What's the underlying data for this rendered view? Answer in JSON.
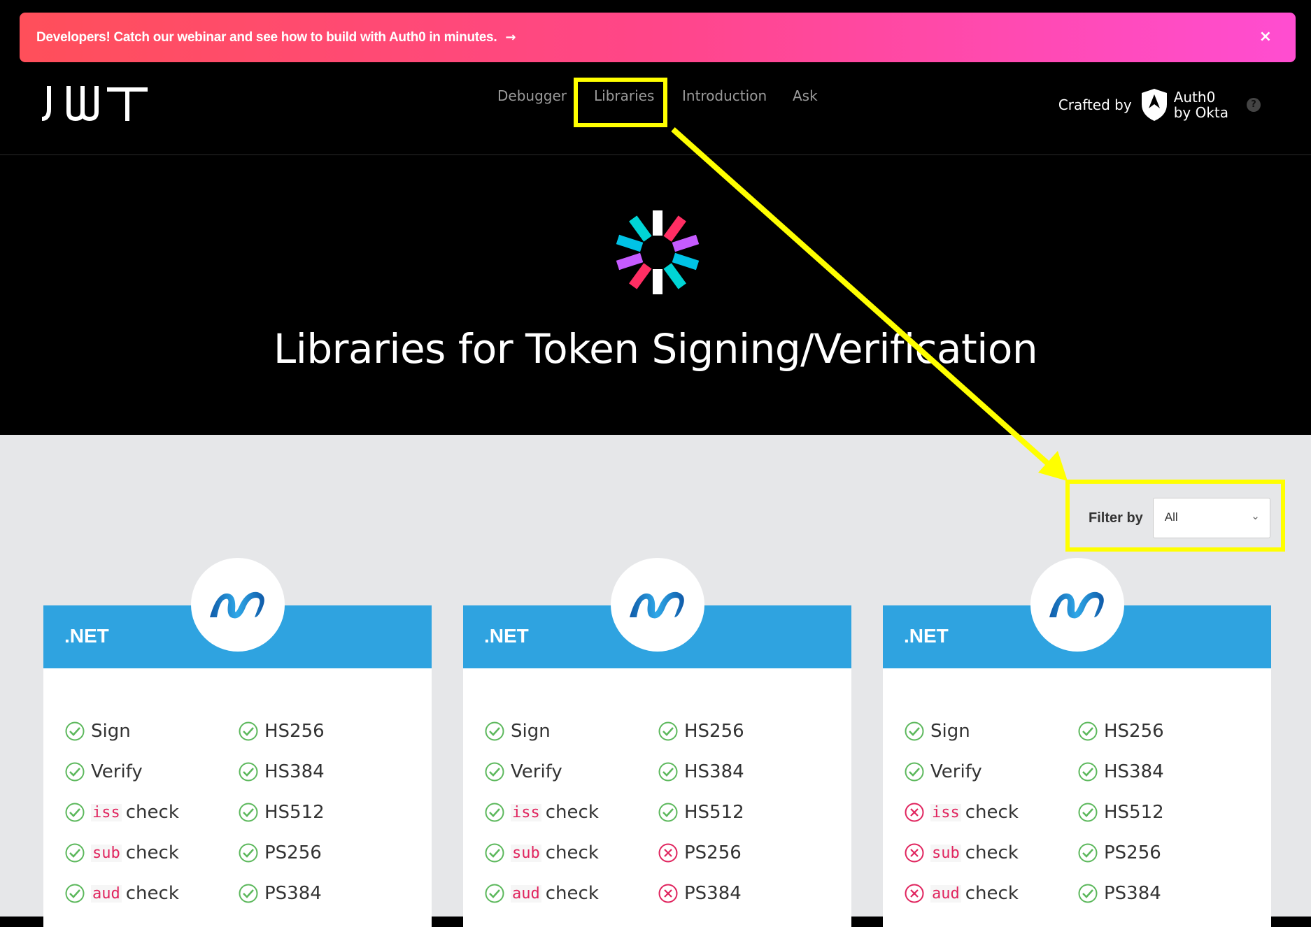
{
  "banner": {
    "text": "Developers! Catch our webinar and see how to build with Auth0 in minutes.",
    "arrow": "→",
    "close": "×"
  },
  "header": {
    "logo_text": "JWT",
    "nav": [
      "Debugger",
      "Libraries",
      "Introduction",
      "Ask"
    ],
    "crafted_by": "Crafted by",
    "brand_line1": "Auth0",
    "brand_line2": "by Okta",
    "help": "?"
  },
  "hero": {
    "title": "Libraries for Token Signing/Verification"
  },
  "filter": {
    "label": "Filter by",
    "value": "All"
  },
  "colors": {
    "accent_blue": "#2fa3e0",
    "check_green": "#5cb85c",
    "cross_red": "#e0245e",
    "highlight": "#ffff00"
  },
  "cards": [
    {
      "title": ".NET",
      "left": [
        {
          "pre": "",
          "code": "",
          "label": "Sign",
          "ok": true
        },
        {
          "pre": "",
          "code": "",
          "label": "Verify",
          "ok": true
        },
        {
          "pre": "",
          "code": "iss",
          "label": "check",
          "ok": true
        },
        {
          "pre": "",
          "code": "sub",
          "label": "check",
          "ok": true
        },
        {
          "pre": "",
          "code": "aud",
          "label": "check",
          "ok": true
        }
      ],
      "right": [
        {
          "label": "HS256",
          "ok": true
        },
        {
          "label": "HS384",
          "ok": true
        },
        {
          "label": "HS512",
          "ok": true
        },
        {
          "label": "PS256",
          "ok": true
        },
        {
          "label": "PS384",
          "ok": true
        }
      ]
    },
    {
      "title": ".NET",
      "left": [
        {
          "pre": "",
          "code": "",
          "label": "Sign",
          "ok": true
        },
        {
          "pre": "",
          "code": "",
          "label": "Verify",
          "ok": true
        },
        {
          "pre": "",
          "code": "iss",
          "label": "check",
          "ok": true
        },
        {
          "pre": "",
          "code": "sub",
          "label": "check",
          "ok": true
        },
        {
          "pre": "",
          "code": "aud",
          "label": "check",
          "ok": true
        }
      ],
      "right": [
        {
          "label": "HS256",
          "ok": true
        },
        {
          "label": "HS384",
          "ok": true
        },
        {
          "label": "HS512",
          "ok": true
        },
        {
          "label": "PS256",
          "ok": false
        },
        {
          "label": "PS384",
          "ok": false
        }
      ]
    },
    {
      "title": ".NET",
      "left": [
        {
          "pre": "",
          "code": "",
          "label": "Sign",
          "ok": true
        },
        {
          "pre": "",
          "code": "",
          "label": "Verify",
          "ok": true
        },
        {
          "pre": "",
          "code": "iss",
          "label": "check",
          "ok": false
        },
        {
          "pre": "",
          "code": "sub",
          "label": "check",
          "ok": false
        },
        {
          "pre": "",
          "code": "aud",
          "label": "check",
          "ok": false
        }
      ],
      "right": [
        {
          "label": "HS256",
          "ok": true
        },
        {
          "label": "HS384",
          "ok": true
        },
        {
          "label": "HS512",
          "ok": true
        },
        {
          "label": "PS256",
          "ok": true
        },
        {
          "label": "PS384",
          "ok": true
        }
      ]
    }
  ]
}
